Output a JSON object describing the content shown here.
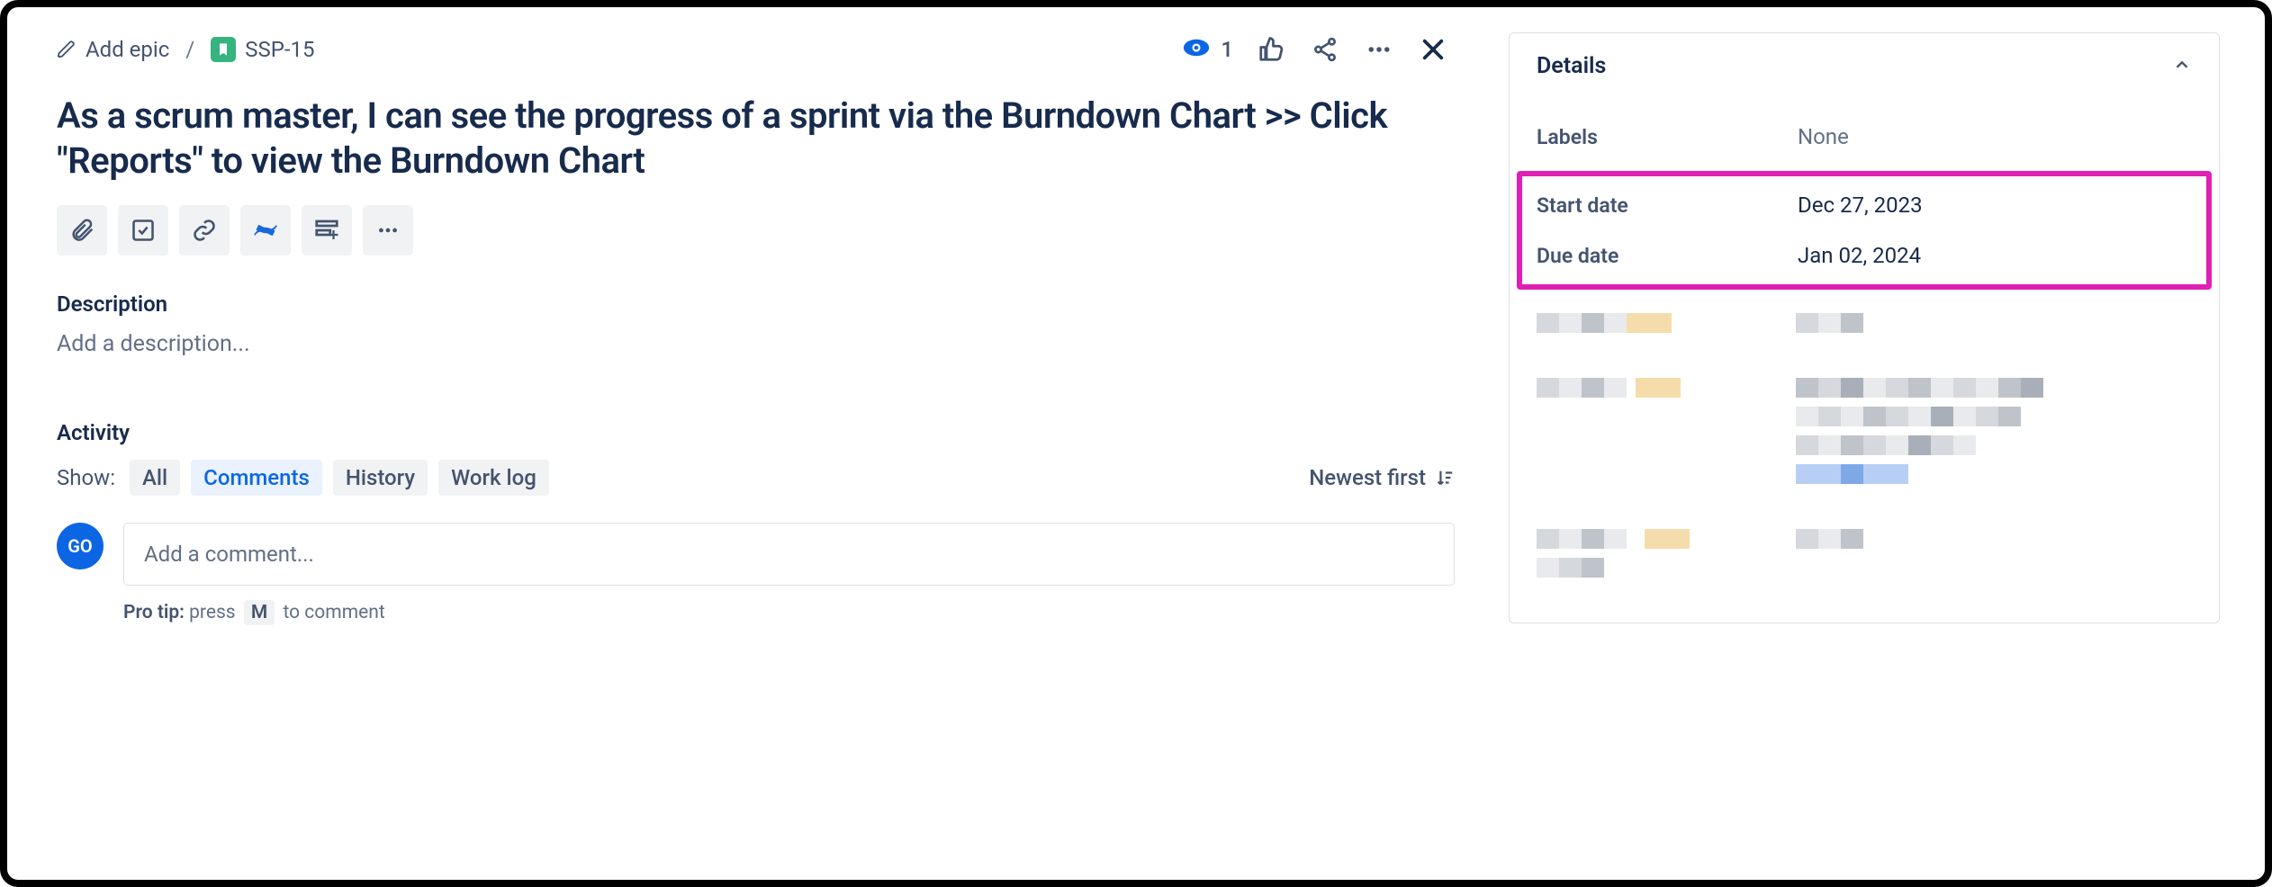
{
  "breadcrumb": {
    "add_epic": "Add epic",
    "issue_key": "SSP-15"
  },
  "header_actions": {
    "watch_count": "1"
  },
  "issue": {
    "title": "As a scrum master, I can see the progress of a sprint via the Burndown Chart >> Click \"Reports\" to view the Burndown Chart"
  },
  "description": {
    "heading": "Description",
    "placeholder": "Add a description..."
  },
  "activity": {
    "heading": "Activity",
    "show_label": "Show:",
    "tabs": {
      "all": "All",
      "comments": "Comments",
      "history": "History",
      "worklog": "Work log"
    },
    "sort_label": "Newest first"
  },
  "comment": {
    "avatar_initials": "GO",
    "placeholder": "Add a comment...",
    "protip_prefix": "Pro tip:",
    "protip_press": "press",
    "protip_key": "M",
    "protip_suffix": "to comment"
  },
  "details": {
    "panel_title": "Details",
    "labels": {
      "label": "Labels",
      "value": "None"
    },
    "start_date": {
      "label": "Start date",
      "value": "Dec 27, 2023"
    },
    "due_date": {
      "label": "Due date",
      "value": "Jan 02, 2024"
    }
  }
}
